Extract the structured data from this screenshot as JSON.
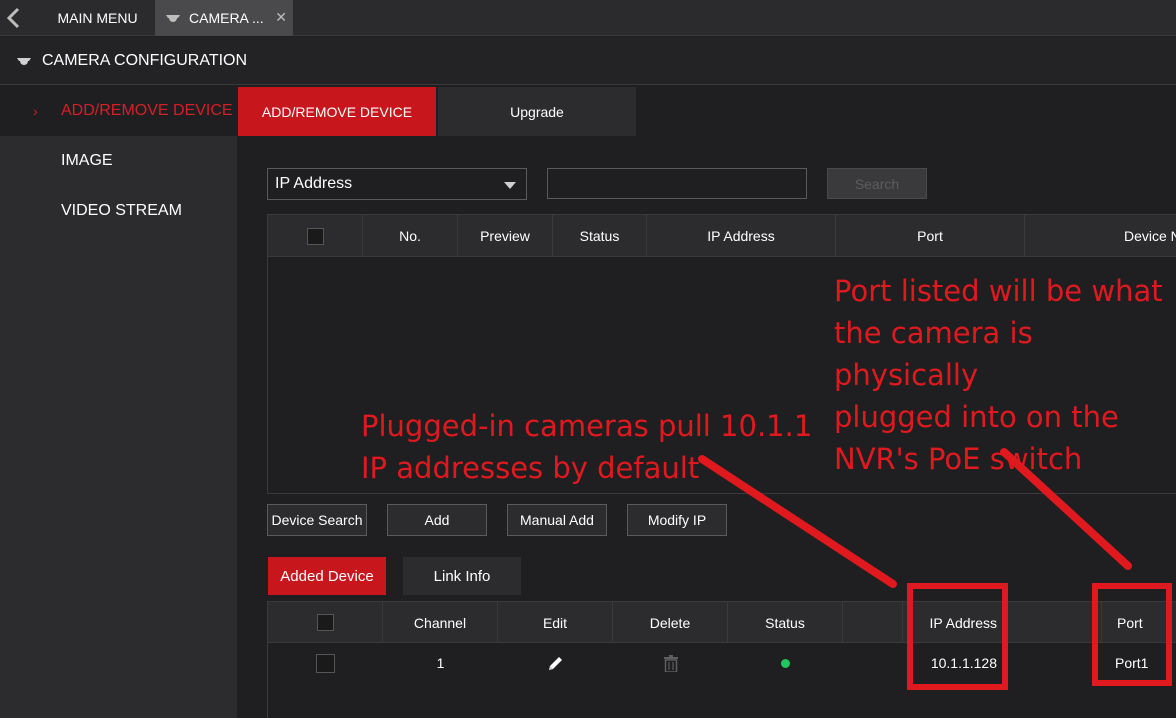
{
  "topbar": {
    "main_menu_label": "MAIN MENU",
    "camera_tab_label": "CAMERA ...",
    "close_glyph": "✕"
  },
  "header": {
    "title": "CAMERA CONFIGURATION"
  },
  "sidebar": {
    "items": [
      {
        "label": "ADD/REMOVE DEVICE",
        "active": true
      },
      {
        "label": "IMAGE",
        "active": false
      },
      {
        "label": "VIDEO STREAM",
        "active": false
      }
    ],
    "active_glyph": "›"
  },
  "subtabs": [
    {
      "label": "ADD/REMOVE DEVICE",
      "active": true
    },
    {
      "label": "Upgrade",
      "active": false
    }
  ],
  "search": {
    "filter_value": "IP Address",
    "input_value": "",
    "button_label": "Search"
  },
  "device_table": {
    "columns": [
      "No.",
      "Preview",
      "Status",
      "IP Address",
      "Port",
      "Device N"
    ]
  },
  "actions": [
    "Device Search",
    "Add",
    "Manual Add",
    "Modify IP"
  ],
  "added_tabs": [
    {
      "label": "Added Device",
      "active": true
    },
    {
      "label": "Link Info",
      "active": false
    }
  ],
  "added_table": {
    "columns": [
      "Channel",
      "Edit",
      "Delete",
      "Status",
      "",
      "IP Address",
      "",
      "Port"
    ],
    "rows": [
      {
        "channel": "1",
        "status": "online",
        "ip": "10.1.1.128",
        "port": "Port1"
      }
    ]
  },
  "annotations": {
    "note_left_line1": "Plugged-in cameras pull 10.1.1",
    "note_left_line2": "IP addresses by default",
    "note_right_line1": "Port listed will be what",
    "note_right_line2": "the camera is physically",
    "note_right_line3": "plugged into on the",
    "note_right_line4": "NVR's PoE switch"
  },
  "colors": {
    "accent_red": "#c8161d",
    "annotation_red": "#e0191f",
    "status_online": "#22c55e",
    "background": "#1f1f21",
    "panel": "#2c2c2e"
  }
}
